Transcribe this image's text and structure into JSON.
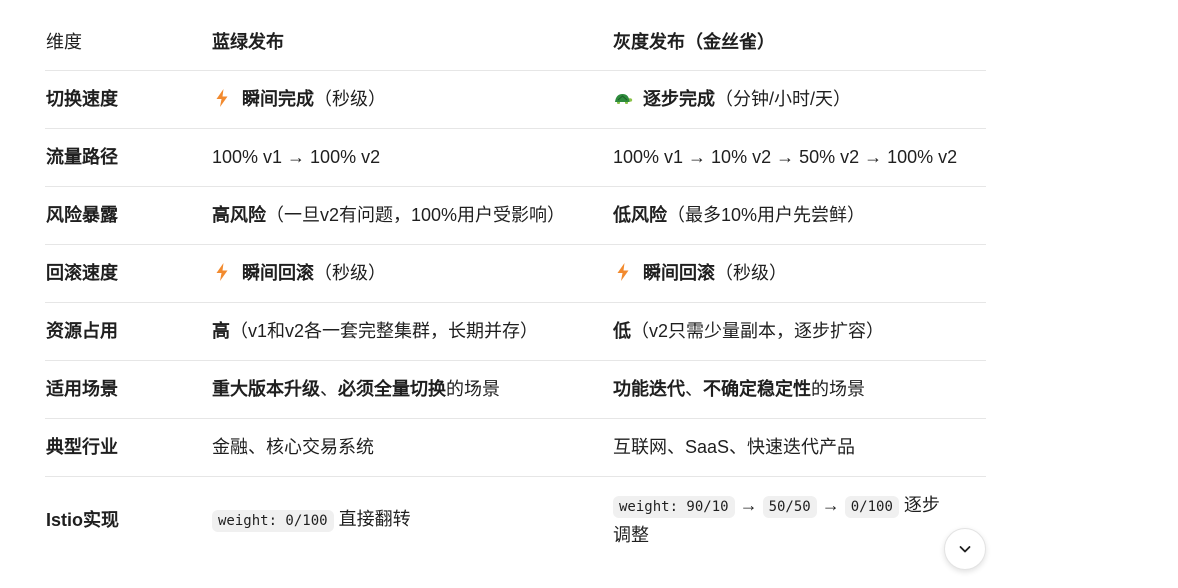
{
  "table": {
    "headers": [
      "维度",
      "蓝绿发布",
      "灰度发布（金丝雀）"
    ],
    "rows": {
      "switch_speed": {
        "label": "切换速度",
        "blue_bold": "瞬间完成",
        "blue_rest": "（秒级）",
        "gray_bold": "逐步完成",
        "gray_rest": "（分钟/小时/天）"
      },
      "traffic_path": {
        "label": "流量路径",
        "blue": "100% v1 → 100% v2",
        "gray": "100% v1 → 10% v2 → 50% v2 → 100% v2"
      },
      "risk": {
        "label": "风险暴露",
        "blue_bold": "高风险",
        "blue_rest": "（一旦v2有问题，100%用户受影响）",
        "gray_bold": "低风险",
        "gray_rest": "（最多10%用户先尝鲜）"
      },
      "rollback": {
        "label": "回滚速度",
        "blue_bold": "瞬间回滚",
        "blue_rest": "（秒级）",
        "gray_bold": "瞬间回滚",
        "gray_rest": "（秒级）"
      },
      "resource": {
        "label": "资源占用",
        "blue_bold": "高",
        "blue_rest": "（v1和v2各一套完整集群，长期并存）",
        "gray_bold": "低",
        "gray_rest": "（v2只需少量副本，逐步扩容）"
      },
      "scenario": {
        "label": "适用场景",
        "blue_bold1": "重大版本升级",
        "blue_sep": "、",
        "blue_bold2": "必须全量切换",
        "blue_rest": "的场景",
        "gray_bold1": "功能迭代",
        "gray_sep": "、",
        "gray_bold2": "不确定稳定性",
        "gray_rest": "的场景"
      },
      "industry": {
        "label": "典型行业",
        "blue": "金融、核心交易系统",
        "gray": "互联网、SaaS、快速迭代产品"
      },
      "istio": {
        "label": "Istio实现",
        "blue_code": "weight: 0/100",
        "blue_rest": " 直接翻转",
        "gray_code1": "weight: 90/10",
        "arrow": "→",
        "gray_code2": "50/50",
        "gray_code3": "0/100",
        "gray_rest": " 逐步调整"
      }
    }
  },
  "icons": {
    "lightning": "lightning-icon",
    "turtle": "turtle-icon",
    "scroll": "chevron-down-icon"
  },
  "colors": {
    "lightning": "#f28a2e",
    "turtle_shell": "#2e8b3d",
    "divider": "#e6e6e6",
    "code_bg": "#f0f0f0"
  }
}
